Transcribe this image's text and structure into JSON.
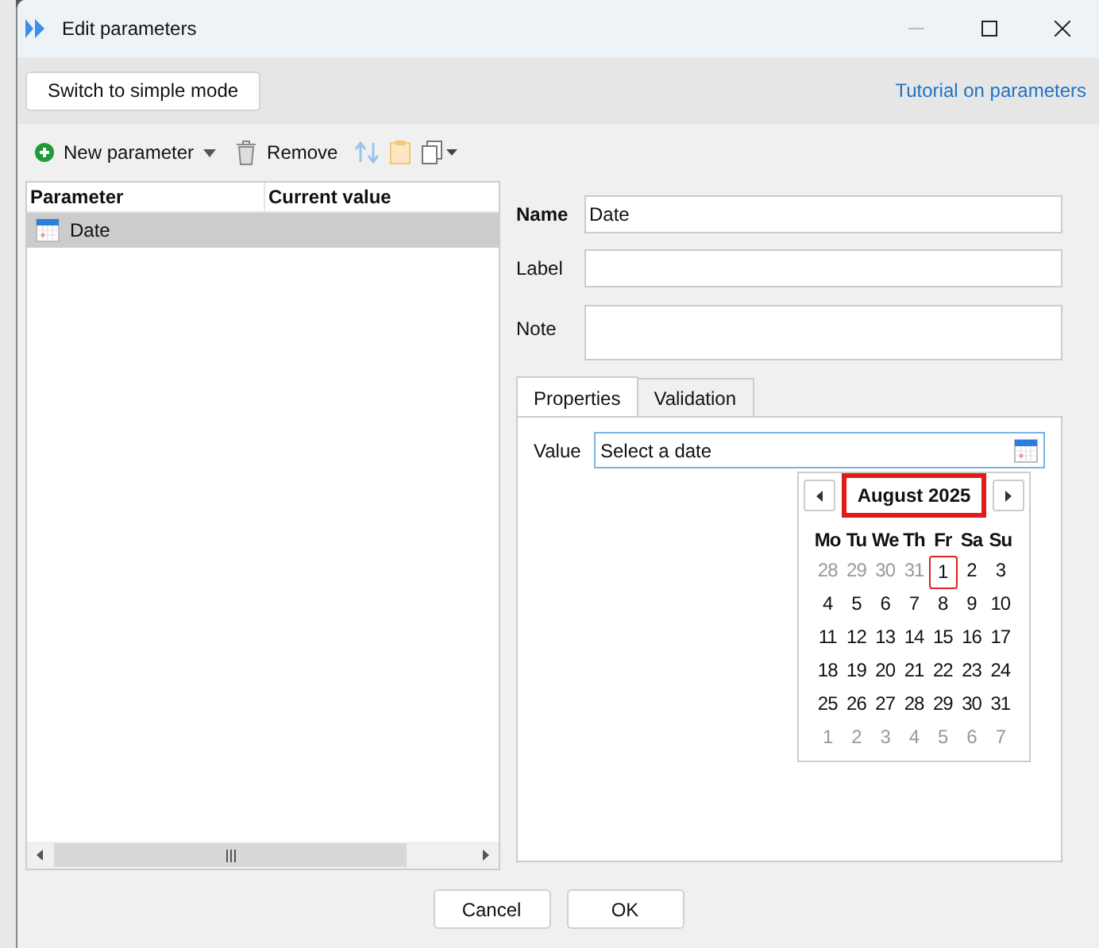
{
  "window": {
    "title": "Edit parameters"
  },
  "top_bar": {
    "mode_button": "Switch to simple mode",
    "tutorial_link": "Tutorial on parameters"
  },
  "toolbar": {
    "new_parameter": "New parameter",
    "remove": "Remove"
  },
  "parameter_list": {
    "columns": [
      "Parameter",
      "Current value"
    ],
    "rows": [
      {
        "name": "Date",
        "value": "",
        "selected": true
      }
    ]
  },
  "details": {
    "name_label": "Name",
    "name_value": "Date",
    "label_label": "Label",
    "note_label": "Note",
    "tabs": [
      {
        "label": "Properties",
        "selected": true
      },
      {
        "label": "Validation",
        "selected": false
      }
    ],
    "value_label": "Value",
    "value_placeholder": "Select a date"
  },
  "calendar": {
    "month": "August 2025",
    "weekdays": [
      "Mo",
      "Tu",
      "We",
      "Th",
      "Fr",
      "Sa",
      "Su"
    ],
    "weeks": [
      [
        {
          "day": "28",
          "outside": true,
          "today": false
        },
        {
          "day": "29",
          "outside": true,
          "today": false
        },
        {
          "day": "30",
          "outside": true,
          "today": false
        },
        {
          "day": "31",
          "outside": true,
          "today": false
        },
        {
          "day": "1",
          "outside": false,
          "today": true
        },
        {
          "day": "2",
          "outside": false,
          "today": false
        },
        {
          "day": "3",
          "outside": false,
          "today": false
        }
      ],
      [
        {
          "day": "4",
          "outside": false,
          "today": false
        },
        {
          "day": "5",
          "outside": false,
          "today": false
        },
        {
          "day": "6",
          "outside": false,
          "today": false
        },
        {
          "day": "7",
          "outside": false,
          "today": false
        },
        {
          "day": "8",
          "outside": false,
          "today": false
        },
        {
          "day": "9",
          "outside": false,
          "today": false
        },
        {
          "day": "10",
          "outside": false,
          "today": false
        }
      ],
      [
        {
          "day": "11",
          "outside": false,
          "today": false
        },
        {
          "day": "12",
          "outside": false,
          "today": false
        },
        {
          "day": "13",
          "outside": false,
          "today": false
        },
        {
          "day": "14",
          "outside": false,
          "today": false
        },
        {
          "day": "15",
          "outside": false,
          "today": false
        },
        {
          "day": "16",
          "outside": false,
          "today": false
        },
        {
          "day": "17",
          "outside": false,
          "today": false
        }
      ],
      [
        {
          "day": "18",
          "outside": false,
          "today": false
        },
        {
          "day": "19",
          "outside": false,
          "today": false
        },
        {
          "day": "20",
          "outside": false,
          "today": false
        },
        {
          "day": "21",
          "outside": false,
          "today": false
        },
        {
          "day": "22",
          "outside": false,
          "today": false
        },
        {
          "day": "23",
          "outside": false,
          "today": false
        },
        {
          "day": "24",
          "outside": false,
          "today": false
        }
      ],
      [
        {
          "day": "25",
          "outside": false,
          "today": false
        },
        {
          "day": "26",
          "outside": false,
          "today": false
        },
        {
          "day": "27",
          "outside": false,
          "today": false
        },
        {
          "day": "28",
          "outside": false,
          "today": false
        },
        {
          "day": "29",
          "outside": false,
          "today": false
        },
        {
          "day": "30",
          "outside": false,
          "today": false
        },
        {
          "day": "31",
          "outside": false,
          "today": false
        }
      ],
      [
        {
          "day": "1",
          "outside": true,
          "today": false
        },
        {
          "day": "2",
          "outside": true,
          "today": false
        },
        {
          "day": "3",
          "outside": true,
          "today": false
        },
        {
          "day": "4",
          "outside": true,
          "today": false
        },
        {
          "day": "5",
          "outside": true,
          "today": false
        },
        {
          "day": "6",
          "outside": true,
          "today": false
        },
        {
          "day": "7",
          "outside": true,
          "today": false
        }
      ]
    ]
  },
  "footer": {
    "buttons": [
      "Cancel",
      "OK"
    ]
  }
}
